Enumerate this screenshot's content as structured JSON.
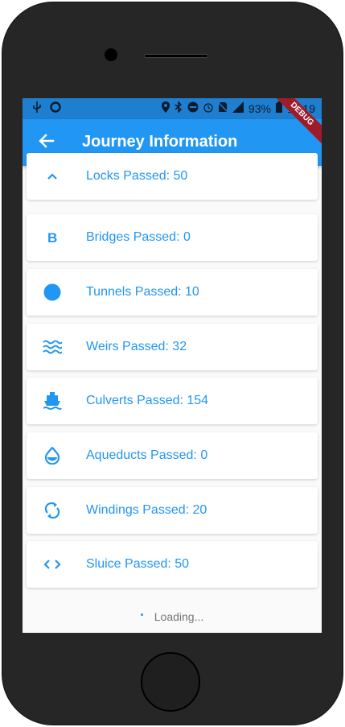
{
  "status_bar": {
    "battery": "93%",
    "time": "10:19"
  },
  "app_bar": {
    "title": "Journey Information"
  },
  "debug_banner": "DEBUG",
  "items": [
    {
      "icon": "chevron-up-icon",
      "label": "Locks Passed: 50"
    },
    {
      "icon": "bold-b-icon",
      "label": "Bridges Passed: 0"
    },
    {
      "icon": "circle-icon",
      "label": "Tunnels Passed: 10"
    },
    {
      "icon": "waves-icon",
      "label": "Weirs Passed: 32"
    },
    {
      "icon": "boat-icon",
      "label": "Culverts Passed: 154"
    },
    {
      "icon": "water-drop-icon",
      "label": "Aqueducts Passed: 0"
    },
    {
      "icon": "sync-icon",
      "label": "Windings Passed: 20"
    },
    {
      "icon": "code-icon",
      "label": "Sluice Passed: 50"
    }
  ],
  "loading_text": "Loading..."
}
